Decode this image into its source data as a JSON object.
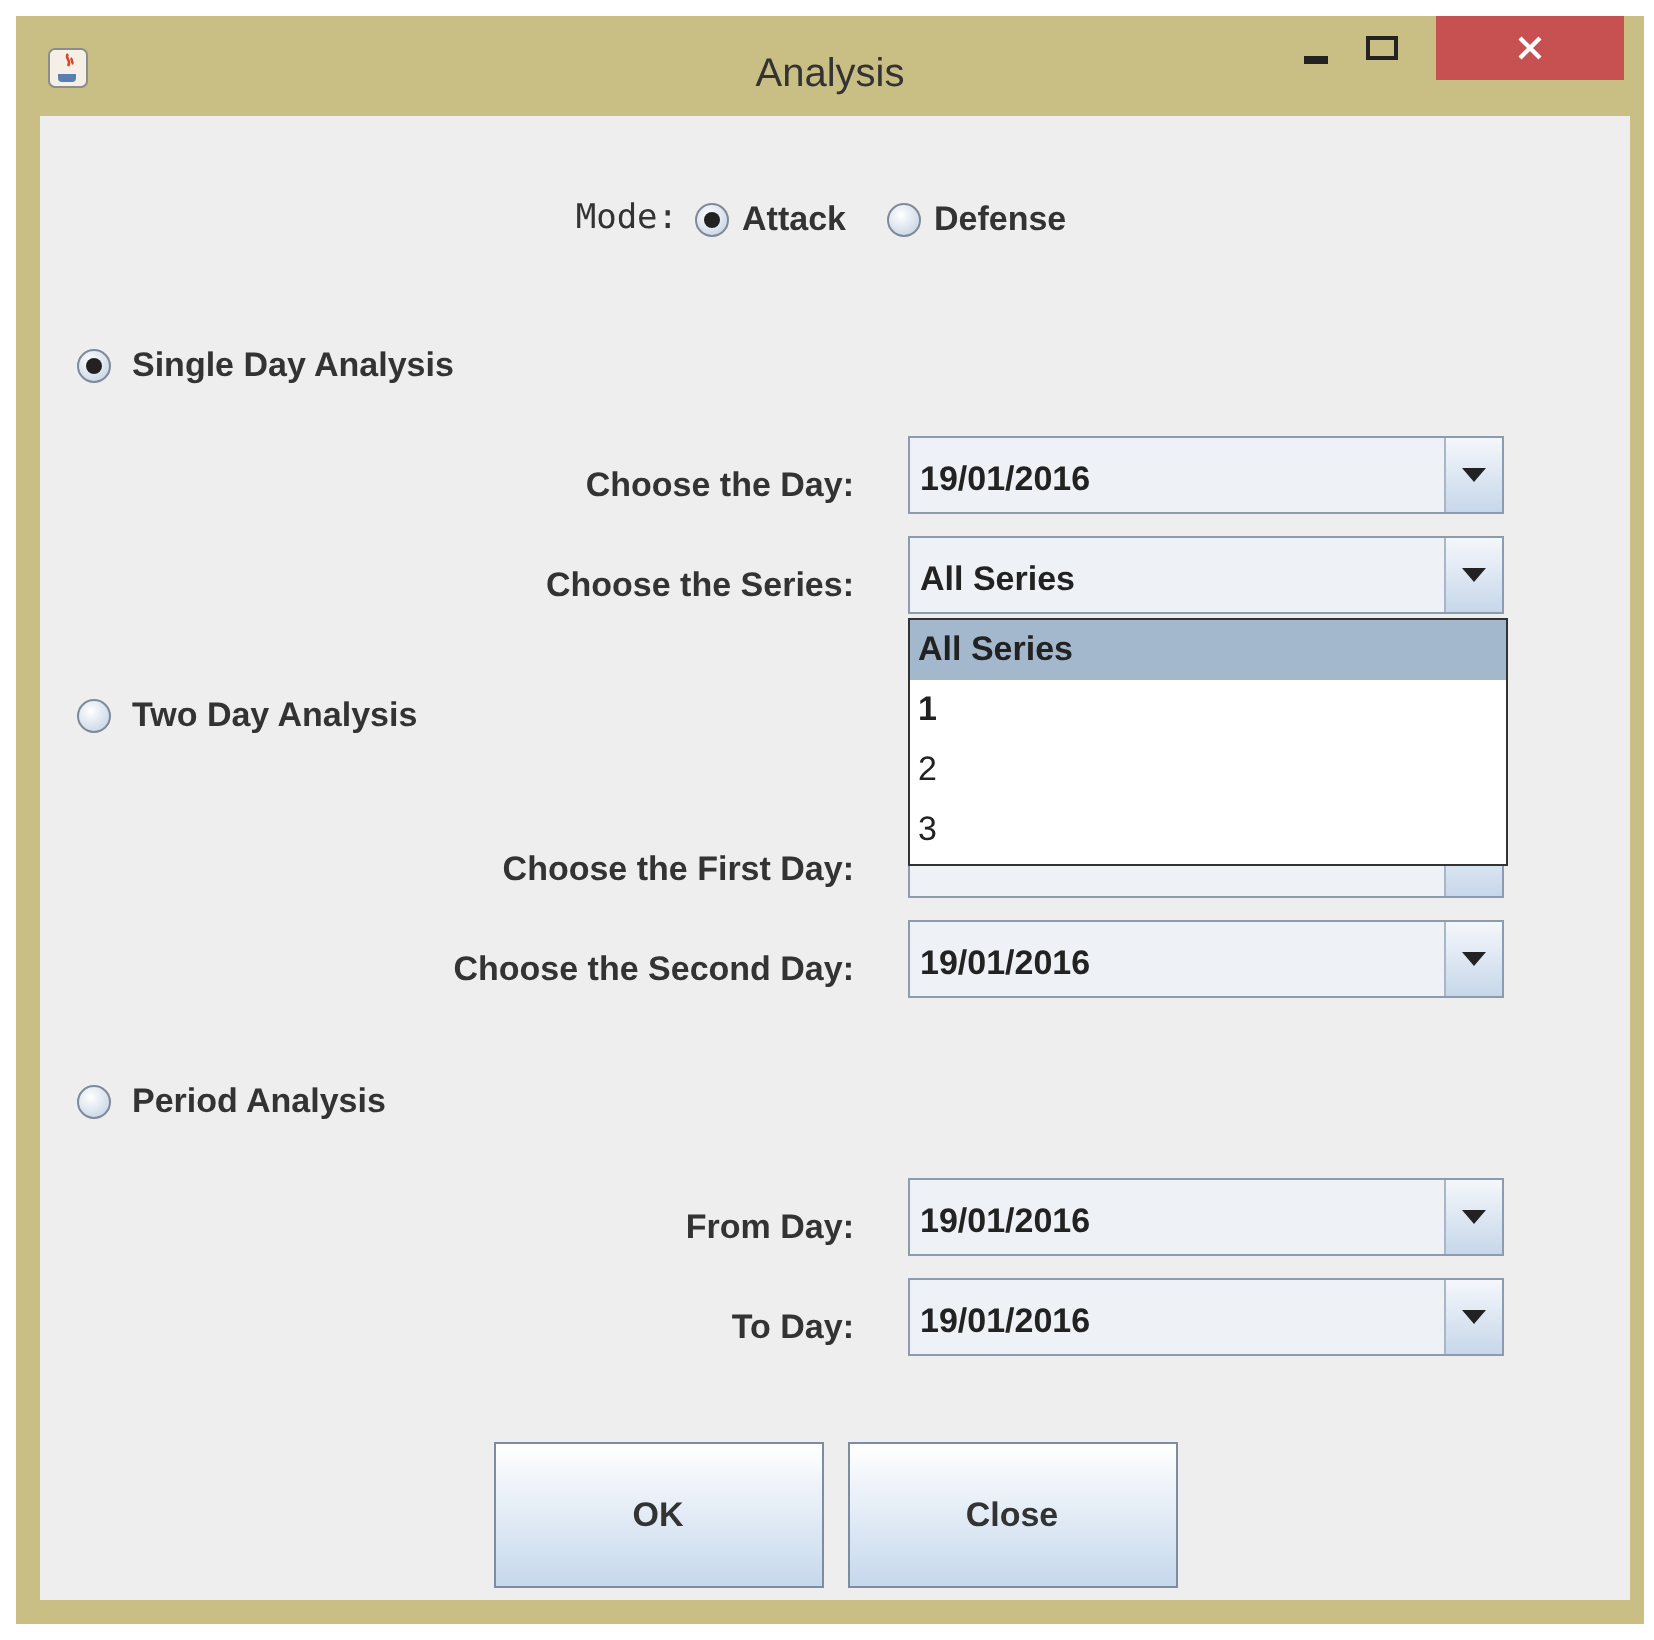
{
  "window": {
    "title": "Analysis"
  },
  "mode": {
    "label": "Mode:",
    "options": [
      {
        "label": "Attack",
        "selected": true
      },
      {
        "label": "Defense",
        "selected": false
      }
    ]
  },
  "sections": [
    {
      "label": "Single Day Analysis",
      "selected": true,
      "fields": [
        {
          "label": "Choose the Day:",
          "value": "19/01/2016"
        },
        {
          "label": "Choose the Series:",
          "value": "All Series",
          "expanded": true,
          "options": [
            {
              "label": "All Series",
              "selected": true
            },
            {
              "label": "1",
              "selected": false
            },
            {
              "label": "2",
              "selected": false
            },
            {
              "label": "3",
              "selected": false
            }
          ]
        }
      ]
    },
    {
      "label": "Two Day Analysis",
      "selected": false,
      "fields": [
        {
          "label": "Choose the First Day:"
        },
        {
          "label": "Choose the Second Day:",
          "value": "19/01/2016"
        }
      ]
    },
    {
      "label": "Period Analysis",
      "selected": false,
      "fields": [
        {
          "label": "From Day:",
          "value": "19/01/2016"
        },
        {
          "label": "To Day:",
          "value": "19/01/2016"
        }
      ]
    }
  ],
  "buttons": [
    "OK",
    "Close"
  ]
}
